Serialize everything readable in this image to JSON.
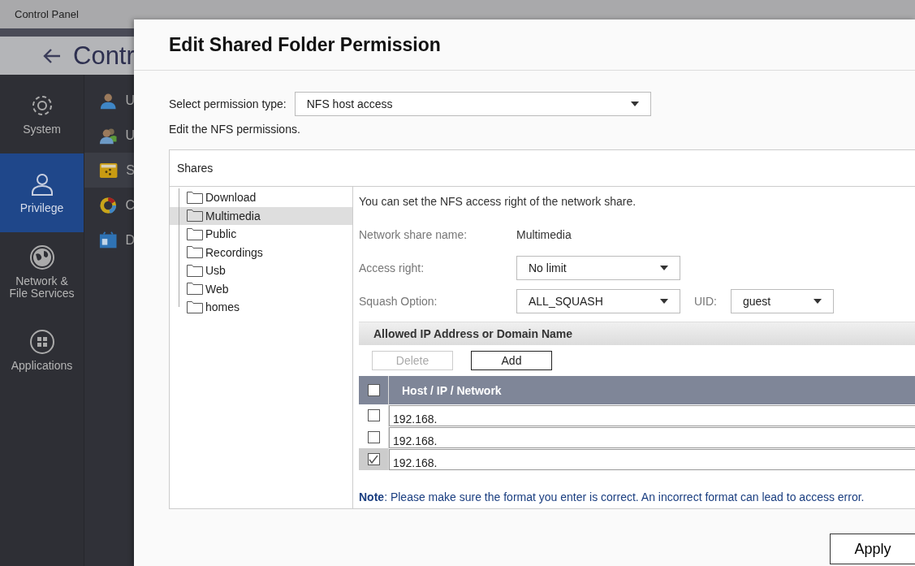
{
  "background": {
    "window_title": "Control Panel",
    "header_title": "Contr",
    "categories": [
      {
        "label": "System",
        "selected": false
      },
      {
        "label": "Privilege",
        "selected": true
      },
      {
        "label": "Network & File Services",
        "selected": false
      },
      {
        "label": "Applications",
        "selected": false
      }
    ],
    "subitems": [
      {
        "label": "U",
        "selected": false
      },
      {
        "label": "U",
        "selected": false
      },
      {
        "label": "S",
        "selected": true
      },
      {
        "label": "C",
        "selected": false
      },
      {
        "label": "D",
        "selected": false
      }
    ]
  },
  "dialog": {
    "title": "Edit Shared Folder Permission",
    "permission_type": {
      "label": "Select permission type:",
      "value": "NFS host access"
    },
    "description": "Edit the NFS permissions.",
    "shares_heading": "Shares",
    "shares": [
      {
        "label": "Download",
        "selected": false
      },
      {
        "label": "Multimedia",
        "selected": true
      },
      {
        "label": "Public",
        "selected": false
      },
      {
        "label": "Recordings",
        "selected": false
      },
      {
        "label": "Usb",
        "selected": false
      },
      {
        "label": "Web",
        "selected": false
      },
      {
        "label": "homes",
        "selected": false
      }
    ],
    "intro": "You can set the NFS access right of the network share.",
    "share_name": {
      "label": "Network share name:",
      "value": "Multimedia"
    },
    "access_right": {
      "label": "Access right:",
      "value": "No limit"
    },
    "squash": {
      "label": "Squash Option:",
      "value": "ALL_SQUASH"
    },
    "uid": {
      "label": "UID:",
      "value": "guest"
    },
    "allowed_heading": "Allowed IP Address or Domain Name",
    "buttons": [
      {
        "label": "Delete",
        "disabled": true
      },
      {
        "label": "Add",
        "disabled": false
      }
    ],
    "table": {
      "header_checked": false,
      "column": "Host / IP / Network",
      "rows": [
        {
          "host": "192.168.",
          "checked": false
        },
        {
          "host": "192.168.",
          "checked": false
        },
        {
          "host": "192.168.",
          "checked": true
        }
      ]
    },
    "note": "**Note**: Please make sure the format you enter is correct. An incorrect format can lead to access error.",
    "apply": "Apply"
  }
}
